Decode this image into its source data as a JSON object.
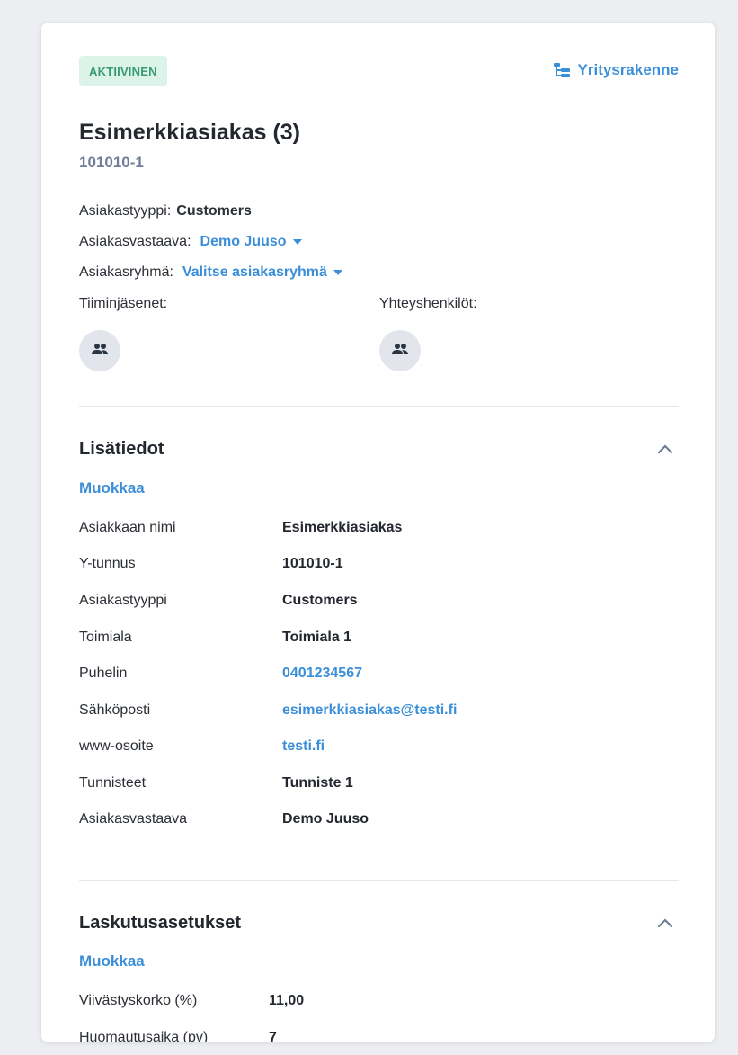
{
  "status_badge": "AKTIIVINEN",
  "company_structure_label": "Yritysrakenne",
  "customer": {
    "name": "Esimerkkiasiakas (3)",
    "id": "101010-1"
  },
  "meta": {
    "type_label": "Asiakastyyppi:",
    "type_value": "Customers",
    "manager_label": "Asiakasvastaava:",
    "manager_value": "Demo Juuso",
    "group_label": "Asiakasryhmä:",
    "group_value": "Valitse asiakasryhmä",
    "team_label": "Tiiminjäsenet:",
    "contacts_label": "Yhteyshenkilöt:"
  },
  "details": {
    "title": "Lisätiedot",
    "edit_label": "Muokkaa",
    "rows": [
      {
        "label": "Asiakkaan nimi",
        "value": "Esimerkkiasiakas"
      },
      {
        "label": "Y-tunnus",
        "value": "101010-1"
      },
      {
        "label": "Asiakastyyppi",
        "value": "Customers"
      },
      {
        "label": "Toimiala",
        "value": "Toimiala 1"
      },
      {
        "label": "Puhelin",
        "value": "0401234567"
      },
      {
        "label": "Sähköposti",
        "value": "esimerkkiasiakas@testi.fi"
      },
      {
        "label": "www-osoite",
        "value": "testi.fi"
      },
      {
        "label": "Tunnisteet",
        "value": "Tunniste 1"
      },
      {
        "label": "Asiakasvastaava",
        "value": "Demo Juuso"
      }
    ]
  },
  "billing": {
    "title": "Laskutusasetukset",
    "edit_label": "Muokkaa",
    "rows": [
      {
        "label": "Viivästyskorko (%)",
        "value": "11,00"
      },
      {
        "label": "Huomautusaika (pv)",
        "value": "7"
      }
    ]
  },
  "icons": {
    "company_structure": "hierarchy-icon",
    "team": "people-icon",
    "contacts": "people-icon",
    "collapse": "chevron-up-icon"
  },
  "colors": {
    "accent": "#3b8fd9",
    "badge_bg": "#dcf3ea",
    "badge_text": "#3a9b73",
    "id_text": "#6f7e99"
  }
}
